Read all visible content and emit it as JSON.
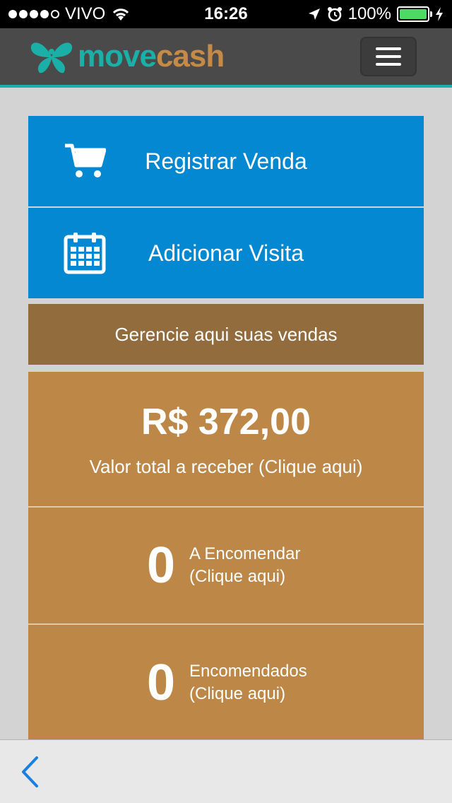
{
  "status_bar": {
    "carrier": "VIVO",
    "time": "16:26",
    "battery": "100%"
  },
  "header": {
    "logo_move": "move",
    "logo_cash": "cash",
    "icons": {
      "menu": "hamburger-icon",
      "logo": "butterfly-logo"
    }
  },
  "actions": {
    "register_sale": {
      "label": "Registrar Venda",
      "icon": "shopping-cart-icon"
    },
    "add_visit": {
      "label": "Adicionar Visita",
      "icon": "calendar-icon"
    }
  },
  "manage": {
    "label": "Gerencie aqui suas vendas"
  },
  "summary": {
    "total_amount": "R$ 372,00",
    "total_caption": "Valor total a receber (Clique aqui)",
    "to_order": {
      "count": "0",
      "line1": "A Encomendar",
      "line2": "(Clique aqui)"
    },
    "ordered": {
      "count": "0",
      "line1": "Encomendados",
      "line2": "(Clique aqui)"
    }
  },
  "colors": {
    "primary_blue": "#0488d1",
    "brown_dark": "#926c3c",
    "brown": "#bd8847",
    "teal": "#1ab0a8"
  }
}
